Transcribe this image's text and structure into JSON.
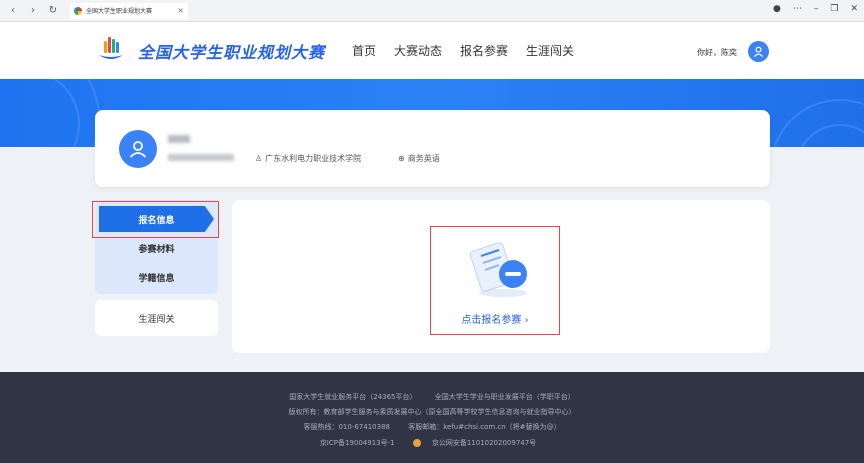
{
  "browser": {
    "tab_title": "全国大学生职业规划大赛",
    "back": "‹",
    "forward": "›",
    "reload": "↻",
    "close": "×"
  },
  "header": {
    "site_title": "全国大学生职业规划大赛",
    "nav": [
      "首页",
      "大赛动态",
      "报名参赛",
      "生涯闯关"
    ],
    "greeting": "你好，陈奕"
  },
  "profile": {
    "school": "广东水利电力职业技术学院",
    "major": "商务英语"
  },
  "sidebar": {
    "items": [
      "报名信息",
      "参赛材料",
      "学籍信息"
    ],
    "active_index": 0,
    "extra": "生涯闯关"
  },
  "content": {
    "cta": "点击报名参赛"
  },
  "footer": {
    "line1a": "国家大学生就业服务平台（24365平台）",
    "line1b": "全国大学生学业与职业发展平台（学职平台）",
    "line2": "版权所有：教育部学生服务与素质发展中心（原全国高等学校学生信息咨询与就业指导中心）",
    "line3a": "客服热线：010-67410388",
    "line3b": "客服邮箱：kefu#chsi.com.cn（将#替换为@）",
    "line4a": "京ICP备19004913号-1",
    "line4b": "京公网安备11010202009747号"
  },
  "colors": {
    "primary": "#1f6fe9",
    "accent_blue": "#3b82f6",
    "footer_bg": "#2f3542",
    "highlight_border": "#ef4444"
  }
}
